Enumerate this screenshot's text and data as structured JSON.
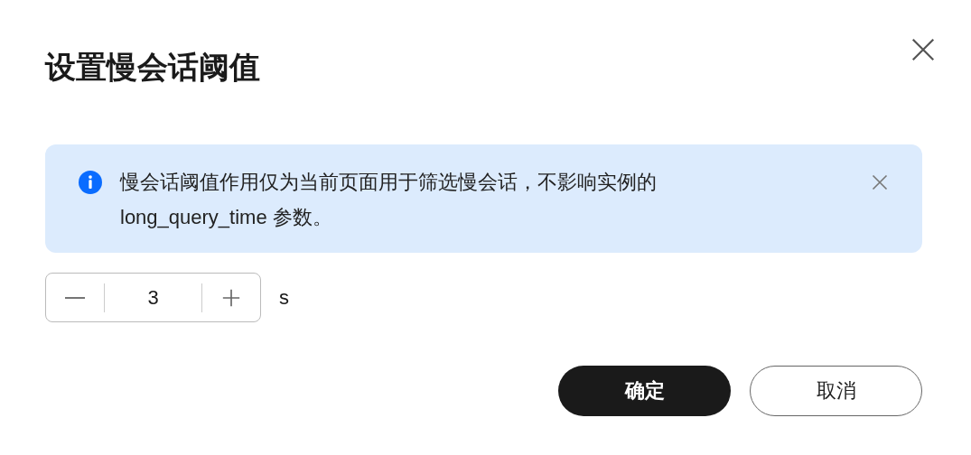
{
  "dialog": {
    "title": "设置慢会话阈值"
  },
  "notice": {
    "text": "慢会话阈值作用仅为当前页面用于筛选慢会话，不影响实例的 long_query_time 参数。"
  },
  "stepper": {
    "value": "3",
    "unit": "s"
  },
  "buttons": [
    {
      "label": "确定",
      "kind": "primary"
    },
    {
      "label": "取消",
      "kind": "secondary"
    }
  ]
}
